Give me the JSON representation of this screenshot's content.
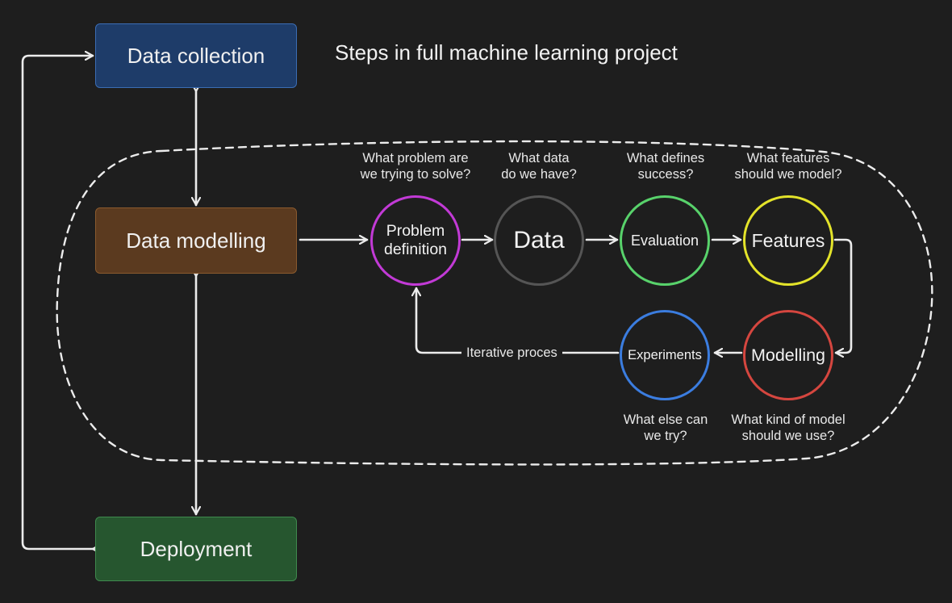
{
  "title": "Steps in full machine learning project",
  "boxes": {
    "collection": "Data collection",
    "modelling": "Data modelling",
    "deployment": "Deployment"
  },
  "steps": [
    {
      "label": "Problem\ndefinition",
      "question": "What problem are\nwe trying to solve?",
      "color": "#c23ad6"
    },
    {
      "label": "Data",
      "question": "What data\ndo we have?",
      "color": "#555555"
    },
    {
      "label": "Evaluation",
      "question": "What defines\nsuccess?",
      "color": "#58d26b"
    },
    {
      "label": "Features",
      "question": "What features\nshould we model?",
      "color": "#e3e32a"
    },
    {
      "label": "Modelling",
      "question": "What kind of model\nshould we use?",
      "color": "#d5463f"
    },
    {
      "label": "Experiments",
      "question": "What else can\nwe try?",
      "color": "#3b7de0"
    }
  ],
  "loop_label": "Iterative proces"
}
